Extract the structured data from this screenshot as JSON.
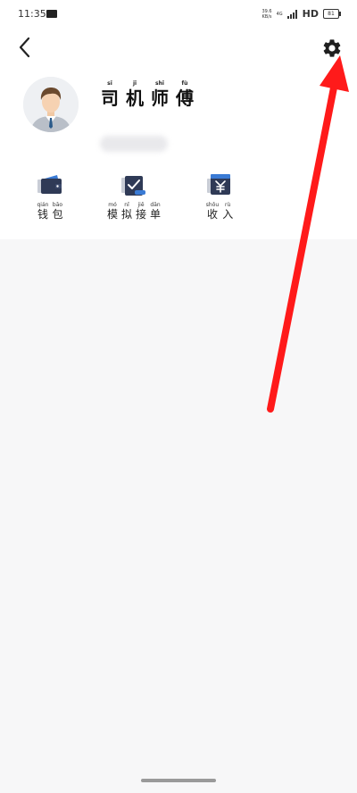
{
  "status_bar": {
    "time": "11:35",
    "speed_value": "39.6",
    "speed_unit": "KB/s",
    "network": "4G",
    "hd": "HD",
    "battery": "81"
  },
  "header": {
    "back_icon": "chevron-left-icon",
    "settings_icon": "gear-icon"
  },
  "profile": {
    "name_chars": [
      {
        "pinyin": "sī",
        "hanzi": "司"
      },
      {
        "pinyin": "jī",
        "hanzi": "机"
      },
      {
        "pinyin": "shī",
        "hanzi": "师"
      },
      {
        "pinyin": "fù",
        "hanzi": "傅"
      }
    ]
  },
  "shortcuts": [
    {
      "icon": "wallet-icon",
      "chars": [
        {
          "pinyin": "qián",
          "hanzi": "钱"
        },
        {
          "pinyin": "bāo",
          "hanzi": "包"
        }
      ]
    },
    {
      "icon": "clipboard-check-icon",
      "chars": [
        {
          "pinyin": "mó",
          "hanzi": "模"
        },
        {
          "pinyin": "nǐ",
          "hanzi": "拟"
        },
        {
          "pinyin": "jiē",
          "hanzi": "接"
        },
        {
          "pinyin": "dān",
          "hanzi": "单"
        }
      ]
    },
    {
      "icon": "yuan-income-icon",
      "chars": [
        {
          "pinyin": "shōu",
          "hanzi": "收"
        },
        {
          "pinyin": "rù",
          "hanzi": "入"
        }
      ]
    }
  ],
  "colors": {
    "accent": "#2f3a56",
    "highlight_blue": "#3a7bd5",
    "annotation_arrow": "#ff1a1a"
  }
}
